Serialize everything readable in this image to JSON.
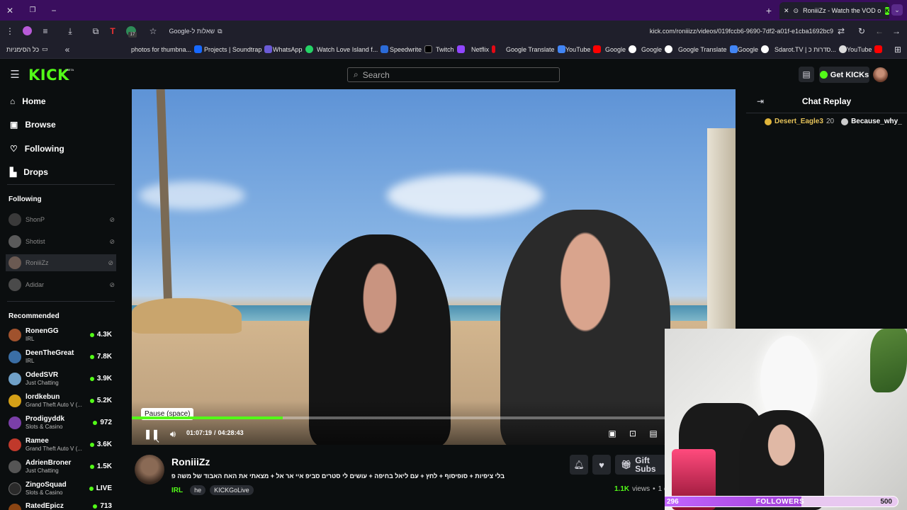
{
  "browser": {
    "active_tab_title": "RoniiiZz - Watch the VOD o",
    "url": "kick.com/roniiizz/videos/019fccb6-9690-7df2-a01f-e1cba1692bc9",
    "google_chip": "Google-שאלות ל",
    "bookmarks_all": "כל הסימניות",
    "bookmarks": [
      "photos for thumbna...",
      "Projects | Soundtrap",
      "WhatsApp",
      "Watch Love Island f...",
      "Speedwrite",
      "Twitch",
      "Netflix",
      "Google Translate",
      "YouTube",
      "Google",
      "Google",
      "Google Translate",
      "Google",
      "Sdarot.TV | סדרות כ...",
      "YouTube"
    ],
    "extension_badge": "17"
  },
  "header": {
    "logo": "KICK",
    "logo_beta": "BETA",
    "search_placeholder": "Search",
    "get_kicks": "Get KICKs"
  },
  "sidebar": {
    "nav": [
      "Home",
      "Browse",
      "Following",
      "Drops"
    ],
    "following_title": "Following",
    "following": [
      "ShonP",
      "Shotist",
      "RoniiiZz",
      "Adidar"
    ],
    "recommended_title": "Recommended",
    "recommended": [
      {
        "name": "RonenGG",
        "category": "IRL",
        "viewers": "4.3K"
      },
      {
        "name": "DeenTheGreat",
        "category": "IRL",
        "viewers": "7.8K"
      },
      {
        "name": "OdedSVR",
        "category": "Just Chatting",
        "viewers": "3.9K"
      },
      {
        "name": "lordkebun",
        "category": "Grand Theft Auto V (...",
        "viewers": "5.2K"
      },
      {
        "name": "Prodigyddk",
        "category": "Slots & Casino",
        "viewers": "972"
      },
      {
        "name": "Ramee",
        "category": "Grand Theft Auto V (...",
        "viewers": "3.6K"
      },
      {
        "name": "AdrienBroner",
        "category": "Just Chatting",
        "viewers": "1.5K"
      },
      {
        "name": "ZingoSquad",
        "category": "Slots & Casino",
        "viewers": "LIVE"
      },
      {
        "name": "RatedEpicz",
        "category": "",
        "viewers": "713"
      }
    ]
  },
  "player": {
    "tooltip": "Pause (space)",
    "time_current": "01:07:19",
    "time_sep": "/",
    "time_total": "04:28:43",
    "progress": 0.25
  },
  "stream": {
    "channel": "RoniiiZz",
    "title": "בלי ציפיות + סופיסוף + לחץ + עם ליאל בחיפה + עושים לי סטרים סביפ איי אר אל + מצאתי את האח האבוד של משה פביגנט",
    "tags": [
      "IRL",
      "he",
      "KICKGoLive"
    ],
    "views": "1.1K",
    "views_label": "views",
    "date_partial": "1 c",
    "gift_subs": "Gift Subs"
  },
  "chat": {
    "title": "Chat Replay",
    "messages": [
      {
        "user": "Desert_Eagle3",
        "text": "20"
      },
      {
        "user": "Because_why_",
        "text": ""
      }
    ]
  },
  "overlay": {
    "followers_left": "296",
    "followers_label": "FOLLOWERS",
    "followers_right": "500"
  }
}
